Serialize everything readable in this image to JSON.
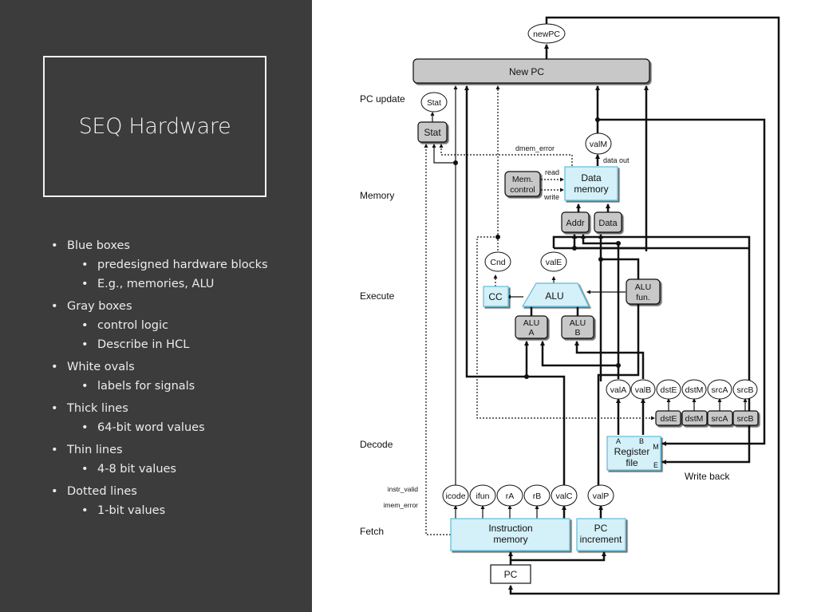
{
  "slide": {
    "title": "SEQ Hardware",
    "bullets": [
      {
        "text": "Blue boxes",
        "sub": [
          "predesigned hardware blocks",
          "E.g., memories, ALU"
        ]
      },
      {
        "text": "Gray boxes",
        "sub": [
          "control logic",
          "Describe in HCL"
        ]
      },
      {
        "text": "White ovals",
        "sub": [
          "labels for signals"
        ]
      },
      {
        "text": "Thick lines",
        "sub": [
          "64-bit word values"
        ]
      },
      {
        "text": "Thin lines",
        "sub": [
          "4-8 bit values"
        ]
      },
      {
        "text": "Dotted lines",
        "sub": [
          "1-bit values"
        ]
      }
    ]
  },
  "diagram": {
    "colors": {
      "blue_box": "#d4f0f8",
      "blue_border": "#5bbcd8",
      "gray_box": "#c8c8c8",
      "panel": "#3c3c3c"
    },
    "stages": {
      "pc_update": "PC update",
      "memory": "Memory",
      "execute": "Execute",
      "decode": "Decode",
      "fetch": "Fetch",
      "write_back": "Write back"
    },
    "blocks": {
      "new_pc": "New PC",
      "stat": "Stat",
      "data_memory": [
        "Data",
        "memory"
      ],
      "mem_control": [
        "Mem.",
        "control"
      ],
      "addr": "Addr",
      "data": "Data",
      "cc": "CC",
      "alu": "ALU",
      "alu_fun": [
        "ALU",
        "fun."
      ],
      "alu_a": [
        "ALU",
        "A"
      ],
      "alu_b": [
        "ALU",
        "B"
      ],
      "register_file": [
        "Register",
        "file"
      ],
      "reg_ports": {
        "a": "A",
        "b": "B",
        "m": "M",
        "e": "E"
      },
      "ctrl_dst_e": "dstE",
      "ctrl_dst_m": "dstM",
      "ctrl_src_a": "srcA",
      "ctrl_src_b": "srcB",
      "instruction_memory": [
        "Instruction",
        "memory"
      ],
      "pc_increment": [
        "PC",
        "increment"
      ],
      "pc": "PC"
    },
    "signals": {
      "new_pc": "newPC",
      "stat": "Stat",
      "val_m": "valM",
      "cnd": "Cnd",
      "val_e": "valE",
      "val_a": "valA",
      "val_b": "valB",
      "dst_e": "dstE",
      "dst_m": "dstM",
      "src_a": "srcA",
      "src_b": "srcB",
      "icode": "icode",
      "ifun": "ifun",
      "r_a": "rA",
      "r_b": "rB",
      "val_c": "valC",
      "val_p": "valP"
    },
    "wire_labels": {
      "dmem_error": "dmem_error",
      "data_out": "data out",
      "read": "read",
      "write": "write",
      "instr_valid": "instr_valid",
      "imem_error": "imem_error"
    }
  }
}
